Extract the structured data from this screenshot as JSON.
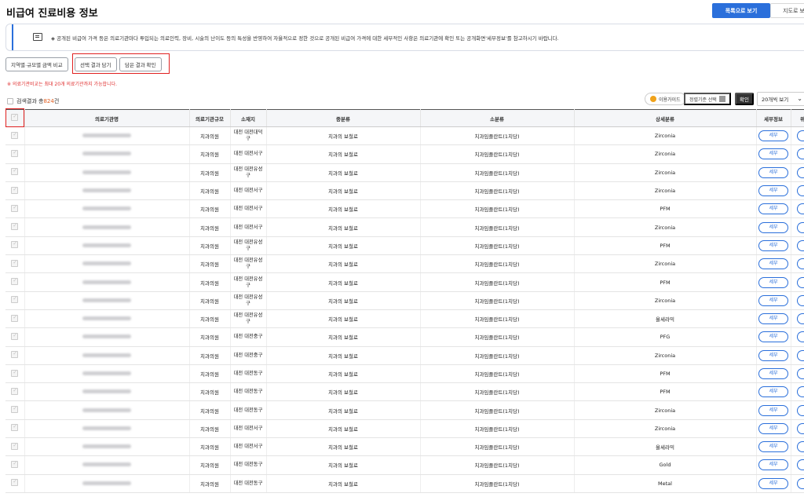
{
  "header": {
    "title": "비급여 진료비용 정보",
    "list_view_label": "목록으로 보기",
    "map_view_label": "지도로 보"
  },
  "notice": {
    "text": "◈ 공개된 비급여 가격 등은 의료기관마다 투입되는 의료인력, 장비, 시술의 난이도 등의 특성을 반영하여 자율적으로 정한 것으로 공개된 비급여 가격에 대한 세부적인 사항은 의료기관에 확인 또는 공개화면'세부정보'를 참고하시기 바랍니다."
  },
  "actions": {
    "region_compare": "지역별·규모별 금액 비교",
    "save_selected": "선택 결과 담기",
    "check_saved": "담은 결과 확인",
    "warning": "※ 의료기관비교는 최대 20개 의료기관까지 가능합니다."
  },
  "results": {
    "label": "검색결과 총",
    "count": "824",
    "unit": "건",
    "guide": "이용가이드",
    "criteria": "정렬기준 선택",
    "confirm": "확인",
    "page_size": "20개씩 보기"
  },
  "table": {
    "headers": [
      "의료기관명",
      "의료기관규모",
      "소재지",
      "중분류",
      "소분류",
      "상세분류",
      "세부정보",
      "위"
    ],
    "detail_label": "세부",
    "rows": [
      {
        "size": "치과의원",
        "loc": "대전 대전대덕구",
        "mid": "치과의 보철료",
        "sub": "치과임플란트(1치당)",
        "detail": "Zirconia"
      },
      {
        "size": "치과의원",
        "loc": "대전 대전서구",
        "mid": "치과의 보철료",
        "sub": "치과임플란트(1치당)",
        "detail": "Zirconia"
      },
      {
        "size": "치과의원",
        "loc": "대전 대전유성구",
        "mid": "치과의 보철료",
        "sub": "치과임플란트(1치당)",
        "detail": "Zirconia"
      },
      {
        "size": "치과의원",
        "loc": "대전 대전서구",
        "mid": "치과의 보철료",
        "sub": "치과임플란트(1치당)",
        "detail": "Zirconia"
      },
      {
        "size": "치과의원",
        "loc": "대전 대전서구",
        "mid": "치과의 보철료",
        "sub": "치과임플란트(1치당)",
        "detail": "PFM"
      },
      {
        "size": "치과의원",
        "loc": "대전 대전서구",
        "mid": "치과의 보철료",
        "sub": "치과임플란트(1치당)",
        "detail": "Zirconia"
      },
      {
        "size": "치과의원",
        "loc": "대전 대전유성구",
        "mid": "치과의 보철료",
        "sub": "치과임플란트(1치당)",
        "detail": "PFM"
      },
      {
        "size": "치과의원",
        "loc": "대전 대전유성구",
        "mid": "치과의 보철료",
        "sub": "치과임플란트(1치당)",
        "detail": "Zirconia"
      },
      {
        "size": "치과의원",
        "loc": "대전 대전유성구",
        "mid": "치과의 보철료",
        "sub": "치과임플란트(1치당)",
        "detail": "PFM"
      },
      {
        "size": "치과의원",
        "loc": "대전 대전유성구",
        "mid": "치과의 보철료",
        "sub": "치과임플란트(1치당)",
        "detail": "Zirconia"
      },
      {
        "size": "치과의원",
        "loc": "대전 대전유성구",
        "mid": "치과의 보철료",
        "sub": "치과임플란트(1치당)",
        "detail": "올세라믹"
      },
      {
        "size": "치과의원",
        "loc": "대전 대전중구",
        "mid": "치과의 보철료",
        "sub": "치과임플란트(1치당)",
        "detail": "PFG"
      },
      {
        "size": "치과의원",
        "loc": "대전 대전중구",
        "mid": "치과의 보철료",
        "sub": "치과임플란트(1치당)",
        "detail": "Zirconia"
      },
      {
        "size": "치과의원",
        "loc": "대전 대전동구",
        "mid": "치과의 보철료",
        "sub": "치과임플란트(1치당)",
        "detail": "PFM"
      },
      {
        "size": "치과의원",
        "loc": "대전 대전동구",
        "mid": "치과의 보철료",
        "sub": "치과임플란트(1치당)",
        "detail": "PFM"
      },
      {
        "size": "치과의원",
        "loc": "대전 대전동구",
        "mid": "치과의 보철료",
        "sub": "치과임플란트(1치당)",
        "detail": "Zirconia"
      },
      {
        "size": "치과의원",
        "loc": "대전 대전서구",
        "mid": "치과의 보철료",
        "sub": "치과임플란트(1치당)",
        "detail": "Zirconia"
      },
      {
        "size": "치과의원",
        "loc": "대전 대전서구",
        "mid": "치과의 보철료",
        "sub": "치과임플란트(1치당)",
        "detail": "올세라믹"
      },
      {
        "size": "치과의원",
        "loc": "대전 대전동구",
        "mid": "치과의 보철료",
        "sub": "치과임플란트(1치당)",
        "detail": "Gold"
      },
      {
        "size": "치과의원",
        "loc": "대전 대전동구",
        "mid": "치과의 보철료",
        "sub": "치과임플란트(1치당)",
        "detail": "Metal"
      }
    ]
  }
}
